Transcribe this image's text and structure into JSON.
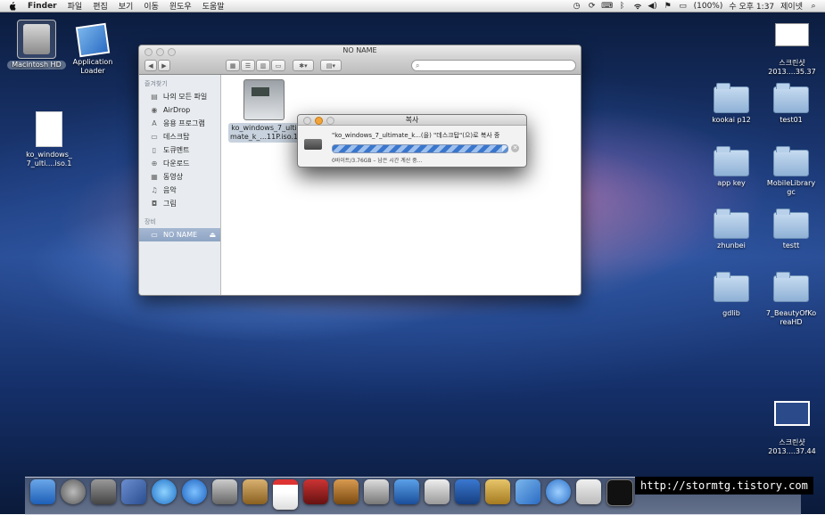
{
  "menubar": {
    "apple_icon": "apple-icon",
    "app_name": "Finder",
    "menus": [
      "파일",
      "편집",
      "보기",
      "이동",
      "윈도우",
      "도움말"
    ],
    "status": {
      "battery": "(100%)",
      "time": "수 오후 1:37",
      "user": "제이넷"
    }
  },
  "desktop": {
    "hd_label": "Macintosh HD",
    "app_loader_label_1": "Application",
    "app_loader_label_2": "Loader",
    "iso_label_1": "ko_windows_",
    "iso_label_2": "7_ulti....iso.1",
    "screenshot_1_line1": "스크린샷",
    "screenshot_1_line2": "2013....35.37",
    "screenshot_2_line1": "스크린샷",
    "screenshot_2_line2": "2013....37.44",
    "folders": [
      {
        "line1": "kookai p12",
        "line2": ""
      },
      {
        "line1": "test01",
        "line2": ""
      },
      {
        "line1": "app key",
        "line2": ""
      },
      {
        "line1": "MobileLibrary",
        "line2": "gc"
      },
      {
        "line1": "zhunbei",
        "line2": ""
      },
      {
        "line1": "testt",
        "line2": ""
      },
      {
        "line1": "gdlib",
        "line2": ""
      },
      {
        "line1": "7_BeautyOfKo",
        "line2": "reaHD"
      }
    ]
  },
  "finder": {
    "title": "NO NAME",
    "sidebar": {
      "favorites_header": "즐겨찾기",
      "items": [
        {
          "label": "나의 모든 파일",
          "icon": "all-files-icon"
        },
        {
          "label": "AirDrop",
          "icon": "airdrop-icon"
        },
        {
          "label": "응용 프로그램",
          "icon": "applications-icon"
        },
        {
          "label": "데스크탑",
          "icon": "desktop-icon"
        },
        {
          "label": "도큐멘트",
          "icon": "documents-icon"
        },
        {
          "label": "다운로드",
          "icon": "downloads-icon"
        },
        {
          "label": "동영상",
          "icon": "movies-icon"
        },
        {
          "label": "음악",
          "icon": "music-icon"
        },
        {
          "label": "그림",
          "icon": "pictures-icon"
        }
      ],
      "devices_header": "장비",
      "device": "NO NAME"
    },
    "file": {
      "name_line1": "ko_windows_7_ulti",
      "name_line2": "mate_k_...11P.iso.1"
    }
  },
  "copy_dialog": {
    "title": "복사",
    "message": "\"ko_windows_7_ultimate_k...(을) \"데스크탑\"(으)로 복사 중",
    "progress": 0.97,
    "status": "0바이트/3.76GB – 남은 시간 계산 중..."
  },
  "overlay": {
    "url": "http://stormtg.tistory.com"
  }
}
